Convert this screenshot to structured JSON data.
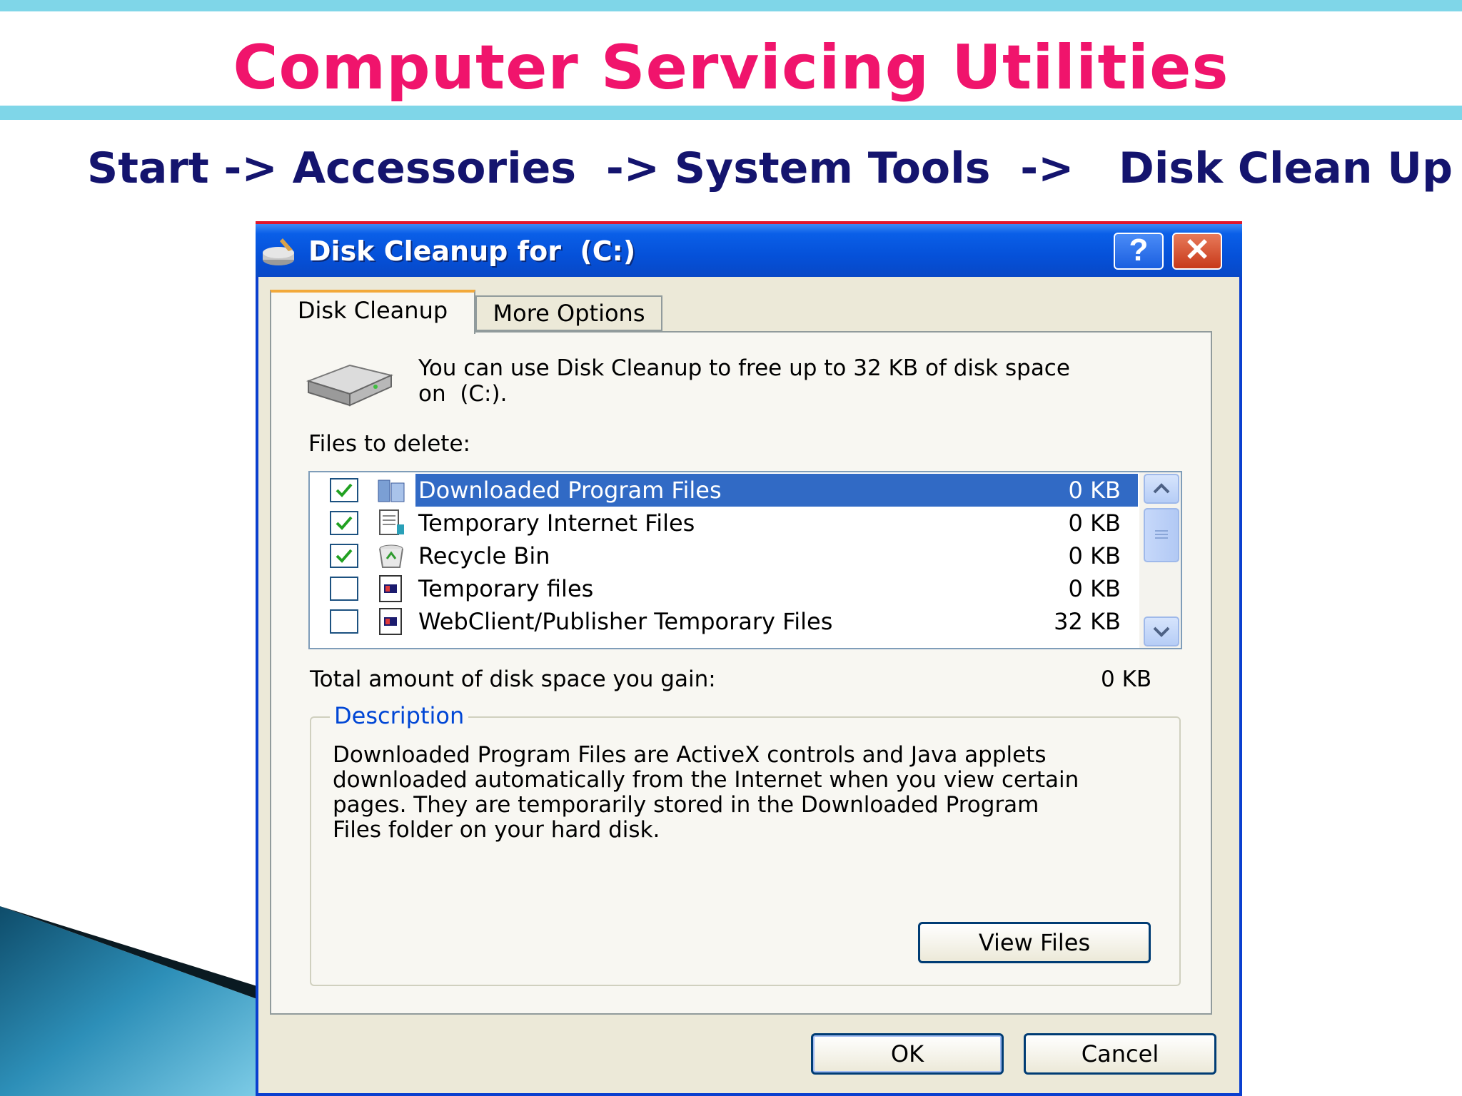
{
  "slide": {
    "title": "Computer Servicing Utilities",
    "path": "Start -> Accessories  -> System Tools  ->   Disk Clean Up"
  },
  "window": {
    "title": "Disk Cleanup for  (C:)",
    "help_label": "?",
    "close_label": "✕"
  },
  "tabs": [
    {
      "label": "Disk Cleanup",
      "active": true
    },
    {
      "label": "More Options",
      "active": false
    }
  ],
  "intro": {
    "line1": "You can use Disk Cleanup to free up to 32 KB of disk space",
    "line2": "on  (C:)."
  },
  "files_label": "Files to delete:",
  "files": [
    {
      "name": "Downloaded Program Files",
      "size": "0 KB",
      "checked": true,
      "selected": true,
      "icon": "folder-icon"
    },
    {
      "name": "Temporary Internet Files",
      "size": "0 KB",
      "checked": true,
      "selected": false,
      "icon": "document-icon"
    },
    {
      "name": "Recycle Bin",
      "size": "0 KB",
      "checked": true,
      "selected": false,
      "icon": "recycle-bin-icon"
    },
    {
      "name": "Temporary files",
      "size": "0 KB",
      "checked": false,
      "selected": false,
      "icon": "temp-file-icon"
    },
    {
      "name": "WebClient/Publisher Temporary Files",
      "size": "32 KB",
      "checked": false,
      "selected": false,
      "icon": "temp-file-icon"
    }
  ],
  "total": {
    "label": "Total amount of disk space you gain:",
    "value": "0 KB"
  },
  "description": {
    "legend": "Description",
    "lines": [
      "Downloaded Program Files are ActiveX controls and Java applets",
      "downloaded automatically from the Internet when you view certain",
      "pages. They are temporarily stored in the Downloaded Program",
      "Files folder on your hard disk."
    ]
  },
  "buttons": {
    "view_files": "View Files",
    "ok": "OK",
    "cancel": "Cancel"
  },
  "colors": {
    "title_pink": "#f0146c",
    "path_navy": "#14146e",
    "band_cyan": "#7fd6e8",
    "xp_blue": "#0551d9",
    "selection": "#316ac5"
  }
}
